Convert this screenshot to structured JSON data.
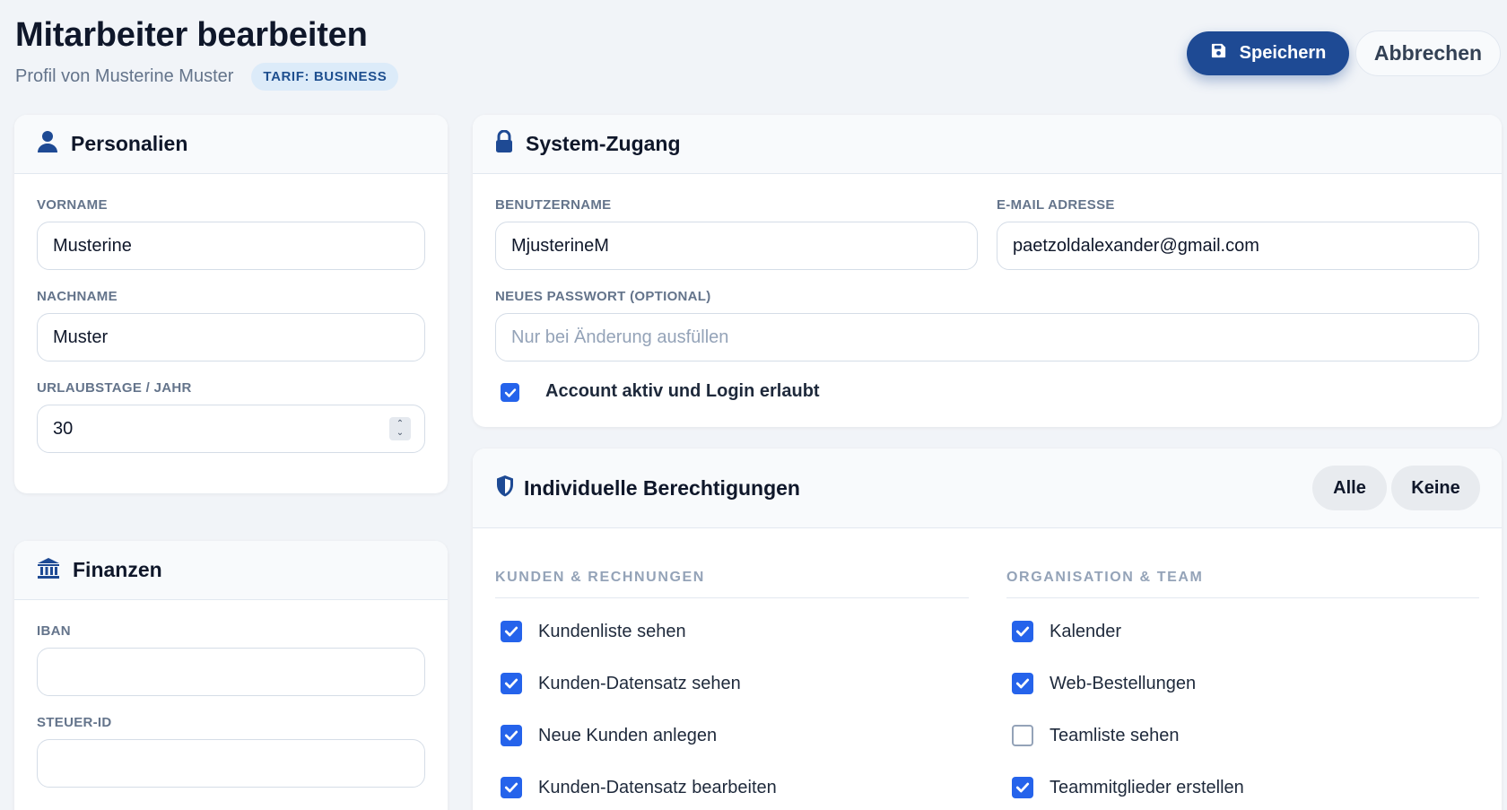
{
  "header": {
    "title": "Mitarbeiter bearbeiten",
    "subtitle": "Profil von Musterine Muster",
    "tarif_badge": "TARIF: BUSINESS",
    "save_label": "Speichern",
    "cancel_label": "Abbrechen"
  },
  "personalien": {
    "title": "Personalien",
    "icon": "person-icon",
    "vorname_label": "VORNAME",
    "vorname_value": "Musterine",
    "nachname_label": "NACHNAME",
    "nachname_value": "Muster",
    "urlaub_label": "URLAUBSTAGE / JAHR",
    "urlaub_value": "30"
  },
  "finanzen": {
    "title": "Finanzen",
    "icon": "bank-icon",
    "iban_label": "IBAN",
    "iban_value": "",
    "steuer_label": "STEUER-ID",
    "steuer_value": ""
  },
  "system": {
    "title": "System-Zugang",
    "icon": "lock-icon",
    "benutzer_label": "BENUTZERNAME",
    "benutzer_value": "MjusterineM",
    "email_label": "E-MAIL ADRESSE",
    "email_value": "paetzoldalexander@gmail.com",
    "passwort_label": "NEUES PASSWORT (OPTIONAL)",
    "passwort_placeholder": "Nur bei Änderung ausfüllen",
    "account_label": "Account aktiv und Login erlaubt",
    "account_checked": true
  },
  "berechtigungen": {
    "title": "Individuelle Berechtigungen",
    "icon": "shield-icon",
    "alle_label": "Alle",
    "keine_label": "Keine",
    "groups": [
      {
        "heading": "KUNDEN & RECHNUNGEN",
        "items": [
          {
            "label": "Kundenliste sehen",
            "checked": true
          },
          {
            "label": "Kunden-Datensatz sehen",
            "checked": true
          },
          {
            "label": "Neue Kunden anlegen",
            "checked": true
          },
          {
            "label": "Kunden-Datensatz bearbeiten",
            "checked": true
          }
        ]
      },
      {
        "heading": "ORGANISATION & TEAM",
        "items": [
          {
            "label": "Kalender",
            "checked": true
          },
          {
            "label": "Web-Bestellungen",
            "checked": true
          },
          {
            "label": "Teamliste sehen",
            "checked": false
          },
          {
            "label": "Teammitglieder erstellen",
            "checked": true
          }
        ]
      }
    ]
  },
  "colors": {
    "primary": "#1e4a94",
    "checkbox": "#2563eb",
    "badge_bg": "#dcebf9",
    "badge_text": "#1e4f8f"
  }
}
